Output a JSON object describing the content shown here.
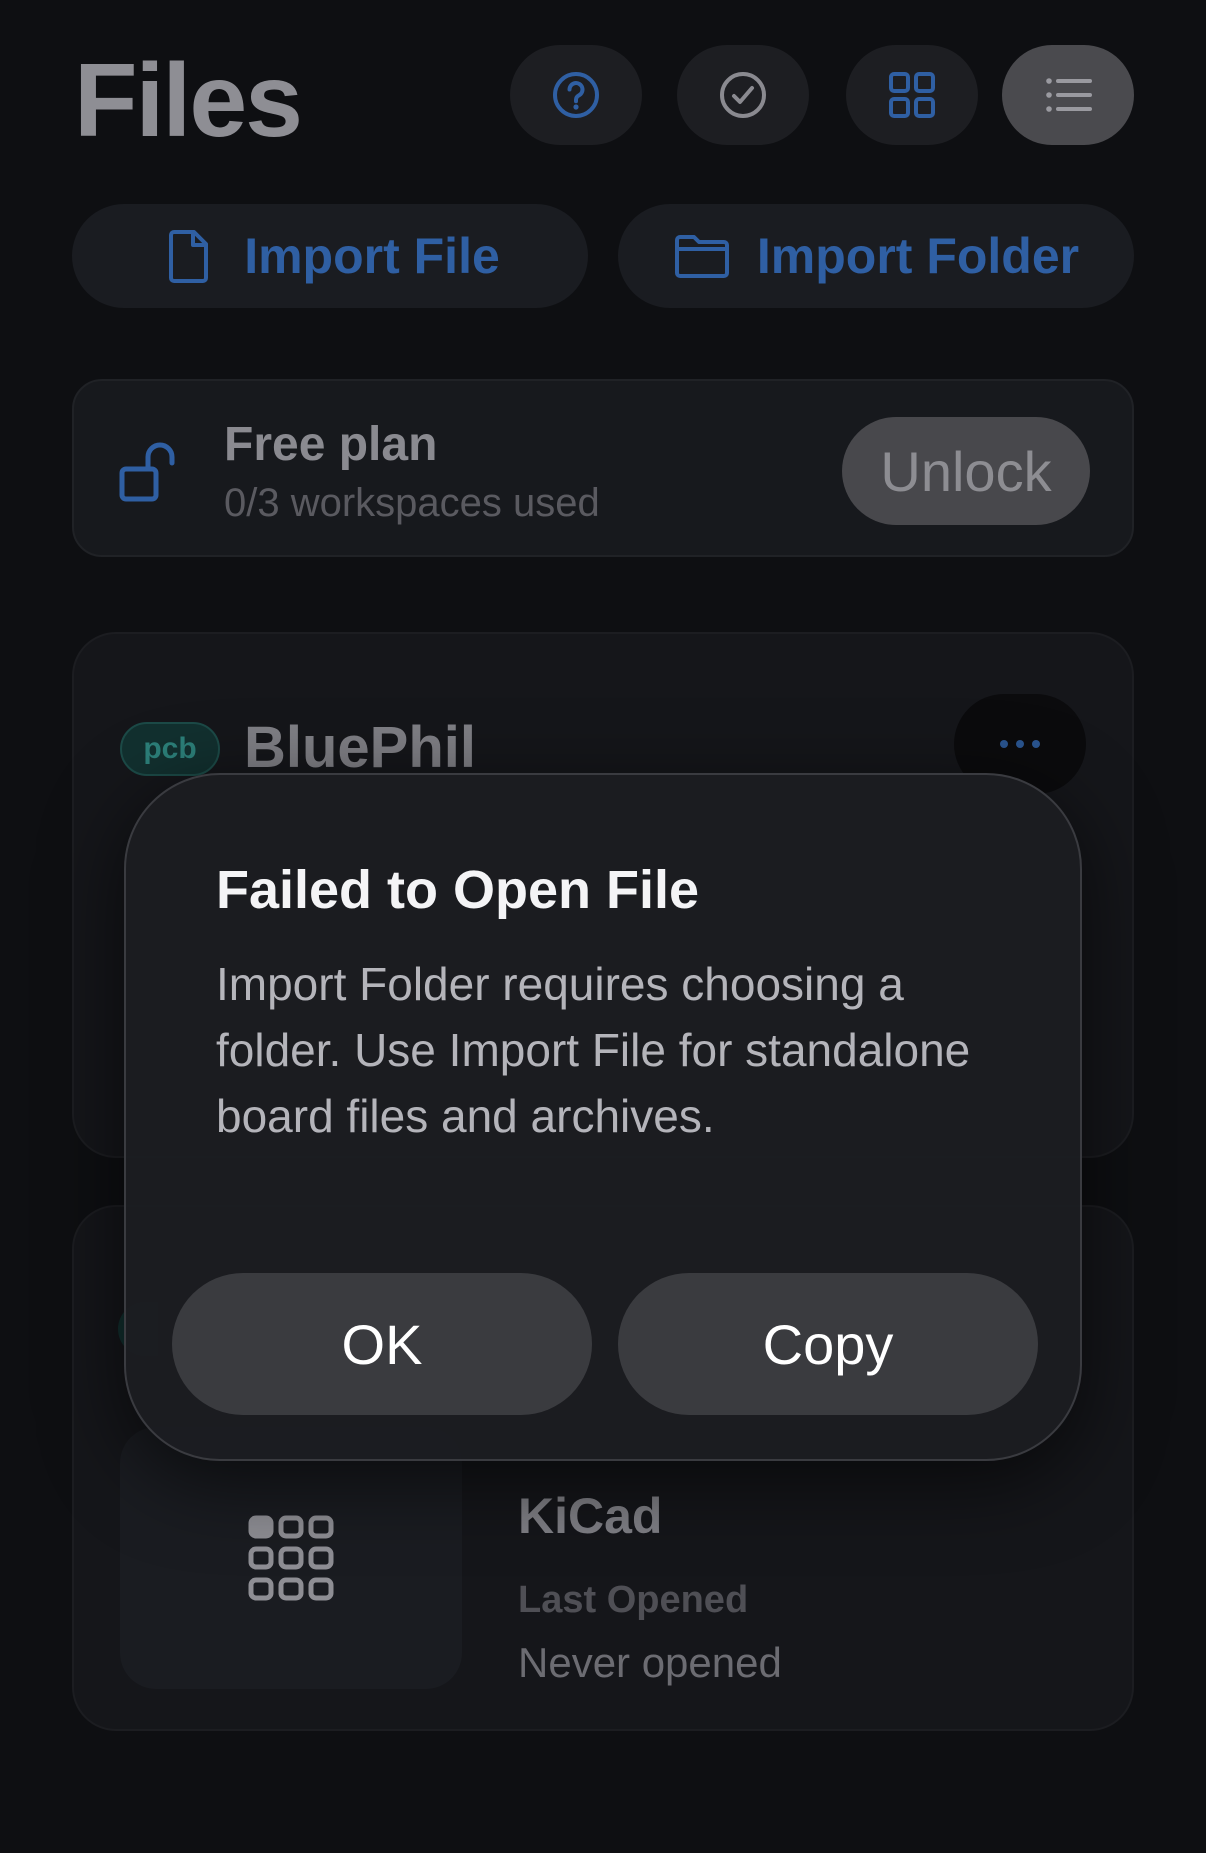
{
  "header": {
    "title": "Files",
    "icons": [
      "question-circle-icon",
      "checkmark-circle-icon",
      "grid-icon",
      "list-icon"
    ]
  },
  "import": {
    "file_label": "Import File",
    "folder_label": "Import Folder"
  },
  "plan": {
    "title": "Free plan",
    "usage": "0/3 workspaces used",
    "unlock_label": "Unlock"
  },
  "workspaces": [
    {
      "badge": "pcb",
      "name": "BluePhil"
    },
    {
      "kind": "KiCad",
      "last_opened_label": "Last Opened",
      "last_opened_value": "Never opened"
    }
  ],
  "dialog": {
    "title": "Failed to Open File",
    "message": "Import Folder requires choosing a folder. Use Import File for standalone board files and archives.",
    "ok_label": "OK",
    "copy_label": "Copy"
  },
  "colors": {
    "background": "#0e0f12",
    "accent_blue": "#2f5fa3",
    "badge_teal": "#2c7f79"
  }
}
